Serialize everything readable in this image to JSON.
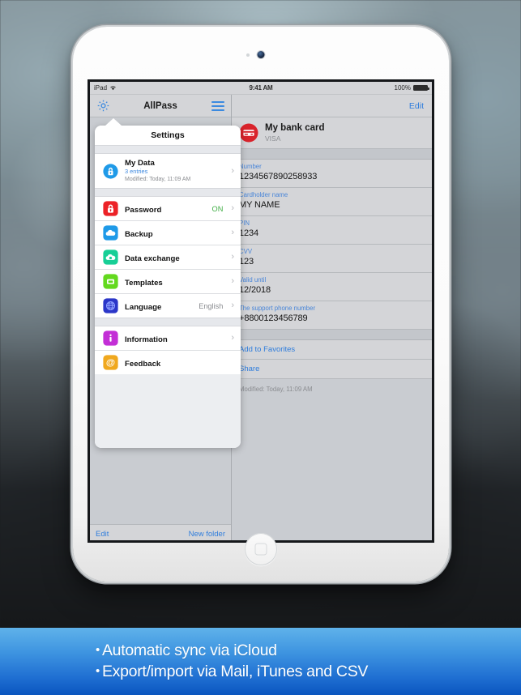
{
  "device": {
    "name": "ipad-mini-white"
  },
  "status_bar": {
    "carrier": "iPad",
    "wifi_icon": "wifi-icon",
    "time": "9:41 AM",
    "battery_percent": "100%",
    "battery_icon": "battery-full-icon"
  },
  "left_pane": {
    "nav": {
      "gear_icon": "gear-icon",
      "title": "AllPass",
      "menu_icon": "hamburger-menu-icon"
    },
    "toolbar": {
      "edit_label": "Edit",
      "new_folder_label": "New folder"
    }
  },
  "popover": {
    "header_title": "Settings",
    "groups": [
      {
        "rows": [
          {
            "icon": "lock-circle-blue-icon",
            "title": "My Data",
            "sub1": "3 entries",
            "sub2": "Modified: Today, 11:09 AM",
            "value": "",
            "chevron": "›"
          }
        ]
      },
      {
        "rows": [
          {
            "icon": "lock-red-icon",
            "title": "Password",
            "sub1": "",
            "sub2": "",
            "value": "ON",
            "value_state": "on",
            "chevron": "›"
          },
          {
            "icon": "cloud-blue-icon",
            "title": "Backup",
            "sub1": "",
            "sub2": "",
            "value": "",
            "value_state": "",
            "chevron": "›"
          },
          {
            "icon": "cloud-green-icon",
            "title": "Data exchange",
            "sub1": "",
            "sub2": "",
            "value": "",
            "value_state": "",
            "chevron": "›"
          },
          {
            "icon": "template-green-icon",
            "title": "Templates",
            "sub1": "",
            "sub2": "",
            "value": "",
            "value_state": "",
            "chevron": "›"
          },
          {
            "icon": "globe-blue-icon",
            "title": "Language",
            "sub1": "",
            "sub2": "",
            "value": "English",
            "value_state": "",
            "chevron": "›"
          }
        ]
      },
      {
        "rows": [
          {
            "icon": "info-purple-icon",
            "title": "Information",
            "sub1": "",
            "sub2": "",
            "value": "",
            "value_state": "",
            "chevron": "›"
          },
          {
            "icon": "at-orange-icon",
            "title": "Feedback",
            "sub1": "",
            "sub2": "",
            "value": "",
            "value_state": "",
            "chevron": ""
          }
        ]
      }
    ]
  },
  "right_pane": {
    "nav": {
      "edit_label": "Edit"
    },
    "card": {
      "icon": "bank-card-red-icon",
      "title": "My bank card",
      "subtitle": "VISA"
    },
    "fields": [
      {
        "label": "Number",
        "value": "1234567890258933"
      },
      {
        "label": "Cardholder name",
        "value": "MY NAME"
      },
      {
        "label": "PIN",
        "value": "1234"
      },
      {
        "label": "CVV",
        "value": "123"
      },
      {
        "label": "Valid until",
        "value": "12/2018"
      },
      {
        "label": "The support phone number",
        "value": "+8800123456789"
      }
    ],
    "actions": [
      {
        "label": "Add to Favorites"
      },
      {
        "label": "Share"
      }
    ],
    "modified_note": "Modified: Today, 11:09 AM"
  },
  "caption": {
    "bullet": "•",
    "lines": [
      "Automatic sync via iCloud",
      "Export/import via Mail, iTunes and CSV"
    ]
  },
  "colors": {
    "accent_blue": "#2f7ddc",
    "label_blue": "#4a86d8",
    "on_green": "#3fae44",
    "banner_top": "#5fb2ea",
    "banner_bottom": "#0a55bf"
  }
}
